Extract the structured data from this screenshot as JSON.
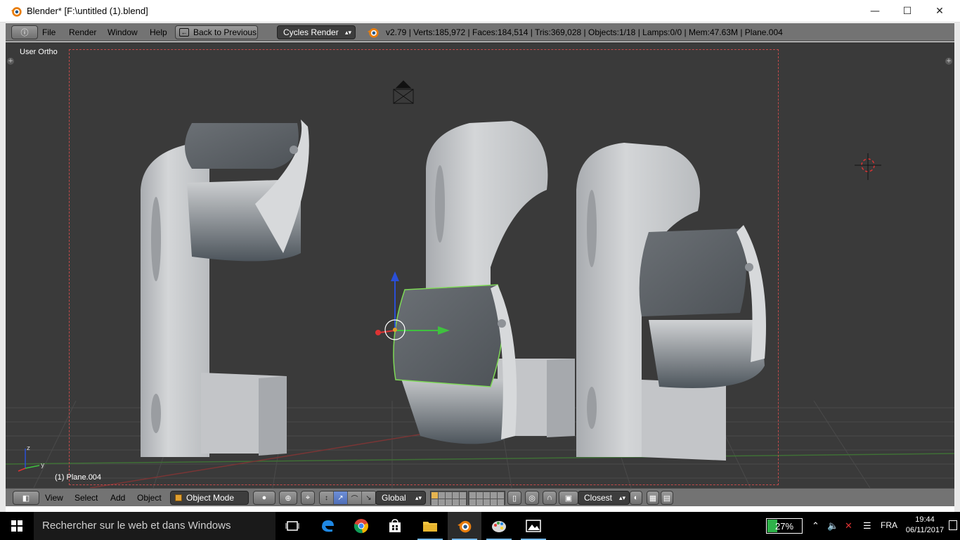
{
  "window": {
    "title": "Blender* [F:\\untitled (1).blend]",
    "minimize_glyph": "—",
    "maximize_glyph": "☐",
    "close_glyph": "✕"
  },
  "info_header": {
    "menus": [
      "File",
      "Render",
      "Window",
      "Help"
    ],
    "back_button": "Back to Previous",
    "render_engine": "Cycles Render",
    "stats": "v2.79 | Verts:185,972 | Faces:184,514 | Tris:369,028 | Objects:1/18 | Lamps:0/0 | Mem:47.63M | Plane.004"
  },
  "viewport": {
    "view_name": "User Ortho",
    "active_object": "(1) Plane.004",
    "colors": {
      "background": "#3a3a3a",
      "model": "#c8cacd",
      "selection_outline": "#7ed957"
    }
  },
  "view_header": {
    "menus": [
      "View",
      "Select",
      "Add",
      "Object"
    ],
    "mode": "Object Mode",
    "orientation": "Global",
    "snap_target": "Closest"
  },
  "taskbar": {
    "search_placeholder": "Rechercher sur le web et dans Windows",
    "apps": [
      "task-view",
      "edge",
      "chrome",
      "store",
      "file-explorer",
      "blender",
      "paint",
      "photos"
    ],
    "battery": "27%",
    "battery_level": 0.27,
    "language": "FRA",
    "time": "19:44",
    "date": "06/11/2017"
  }
}
